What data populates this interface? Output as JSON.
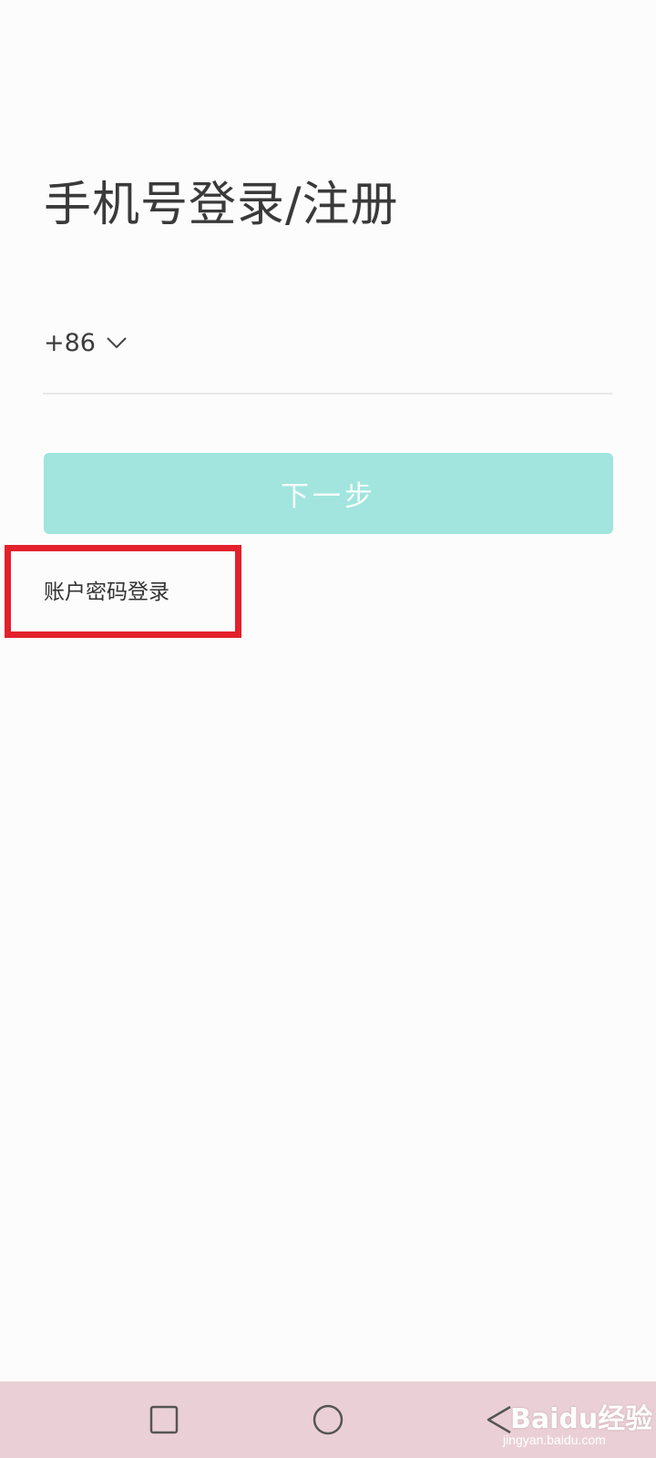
{
  "login": {
    "title": "手机号登录/注册",
    "country_code": "+86",
    "phone_value": "",
    "next_button_label": "下一步",
    "alt_login_link": "账户密码登录"
  },
  "colors": {
    "primary_disabled": "#a1e5de",
    "highlight": "#e3202b",
    "nav_bar_bg": "#ead0d6"
  },
  "nav_bar": {
    "buttons": [
      "recents-square-icon",
      "home-circle-icon",
      "back-triangle-icon"
    ]
  },
  "watermark": {
    "logo": "Baidu经验",
    "url": "jingyan.baidu.com"
  }
}
